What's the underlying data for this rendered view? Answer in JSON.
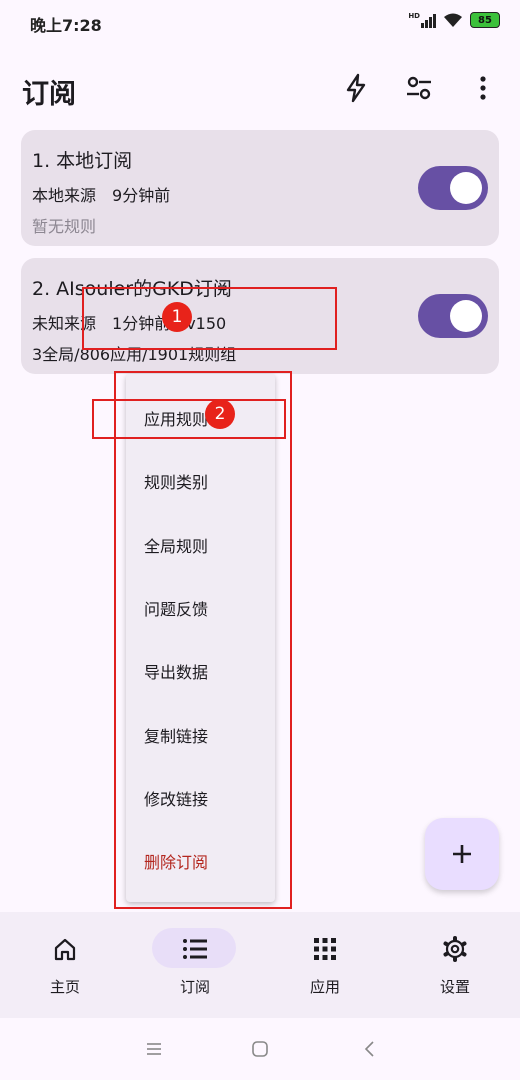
{
  "status_bar": {
    "time": "晚上7:28",
    "signal_label": "HD",
    "battery": "85"
  },
  "app_bar": {
    "title": "订阅",
    "icons": [
      "flash-icon",
      "filter-icon",
      "more-vert-icon"
    ]
  },
  "subscriptions": [
    {
      "title": "1. 本地订阅",
      "source": "本地来源",
      "time": "9分钟前",
      "version": "",
      "rules": "暂无规则",
      "enabled": true
    },
    {
      "title": "2. AIsouler的GKD订阅",
      "source": "未知来源",
      "time": "1分钟前",
      "version": "v150",
      "rules": "3全局/806应用/1901规则组",
      "enabled": true
    }
  ],
  "menu": {
    "items": [
      {
        "label": "应用规则"
      },
      {
        "label": "规则类别"
      },
      {
        "label": "全局规则"
      },
      {
        "label": "问题反馈"
      },
      {
        "label": "导出数据"
      },
      {
        "label": "复制链接"
      },
      {
        "label": "修改链接"
      },
      {
        "label": "删除订阅",
        "danger": true
      }
    ]
  },
  "annotations": {
    "marker_1": "1",
    "marker_2": "2",
    "color": "#e02020"
  },
  "fab": {
    "icon": "add-icon"
  },
  "bottom_nav": {
    "items": [
      {
        "label": "主页",
        "icon": "home-icon",
        "active": false
      },
      {
        "label": "订阅",
        "icon": "list-icon",
        "active": true
      },
      {
        "label": "应用",
        "icon": "apps-grid-icon",
        "active": false
      },
      {
        "label": "设置",
        "icon": "gear-icon",
        "active": false
      }
    ]
  },
  "colors": {
    "accent": "#6750a4",
    "card": "#e8e0ea",
    "danger": "#b3261e",
    "background": "#fdf7ff"
  }
}
